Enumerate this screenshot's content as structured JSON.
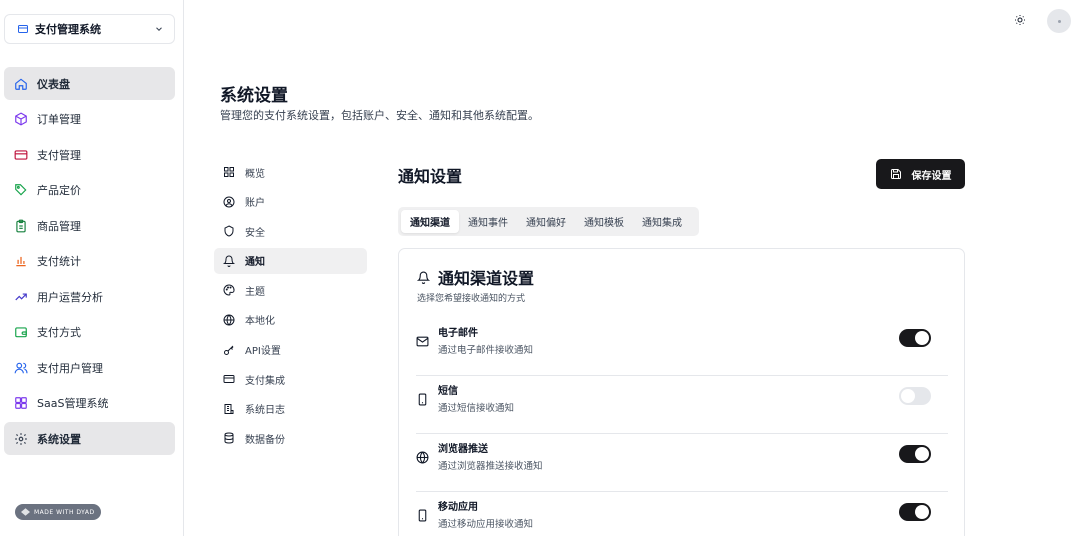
{
  "app_switcher": {
    "label": "支付管理系统"
  },
  "sidebar": {
    "items": [
      {
        "label": "仪表盘",
        "icon": "home-icon",
        "active": true
      },
      {
        "label": "订单管理",
        "icon": "package-icon"
      },
      {
        "label": "支付管理",
        "icon": "credit-card-icon"
      },
      {
        "label": "产品定价",
        "icon": "tag-icon"
      },
      {
        "label": "商品管理",
        "icon": "clipboard-icon"
      },
      {
        "label": "支付统计",
        "icon": "bar-chart-icon"
      },
      {
        "label": "用户运营分析",
        "icon": "trending-icon"
      },
      {
        "label": "支付方式",
        "icon": "wallet-icon"
      },
      {
        "label": "支付用户管理",
        "icon": "users-icon"
      },
      {
        "label": "SaaS管理系统",
        "icon": "layers-icon"
      },
      {
        "label": "系统设置",
        "icon": "gear-icon",
        "active": true
      }
    ],
    "badge": "MADE WITH DYAD"
  },
  "header": {
    "title": "系统设置",
    "subtitle": "管理您的支付系统设置，包括账户、安全、通知和其他系统配置。"
  },
  "settings_nav": {
    "items": [
      {
        "label": "概览",
        "icon": "grid-icon"
      },
      {
        "label": "账户",
        "icon": "user-circle-icon"
      },
      {
        "label": "安全",
        "icon": "shield-icon"
      },
      {
        "label": "通知",
        "icon": "bell-icon",
        "active": true
      },
      {
        "label": "主题",
        "icon": "palette-icon"
      },
      {
        "label": "本地化",
        "icon": "globe-icon"
      },
      {
        "label": "API设置",
        "icon": "key-icon"
      },
      {
        "label": "支付集成",
        "icon": "card-icon"
      },
      {
        "label": "系统日志",
        "icon": "log-icon"
      },
      {
        "label": "数据备份",
        "icon": "database-icon"
      }
    ]
  },
  "section": {
    "title": "通知设置",
    "save_label": "保存设置"
  },
  "tabs": [
    {
      "label": "通知渠道",
      "active": true
    },
    {
      "label": "通知事件"
    },
    {
      "label": "通知偏好"
    },
    {
      "label": "通知模板"
    },
    {
      "label": "通知集成"
    }
  ],
  "card": {
    "title": "通知渠道设置",
    "desc": "选择您希望接收通知的方式",
    "channels": [
      {
        "title": "电子邮件",
        "desc": "通过电子邮件接收通知",
        "icon": "mail-icon",
        "enabled": true
      },
      {
        "title": "短信",
        "desc": "通过短信接收通知",
        "icon": "phone-icon",
        "enabled": false
      },
      {
        "title": "浏览器推送",
        "desc": "通过浏览器推送接收通知",
        "icon": "globe-icon",
        "enabled": true
      },
      {
        "title": "移动应用",
        "desc": "通过移动应用接收通知",
        "icon": "smartphone-icon",
        "enabled": true
      }
    ]
  }
}
